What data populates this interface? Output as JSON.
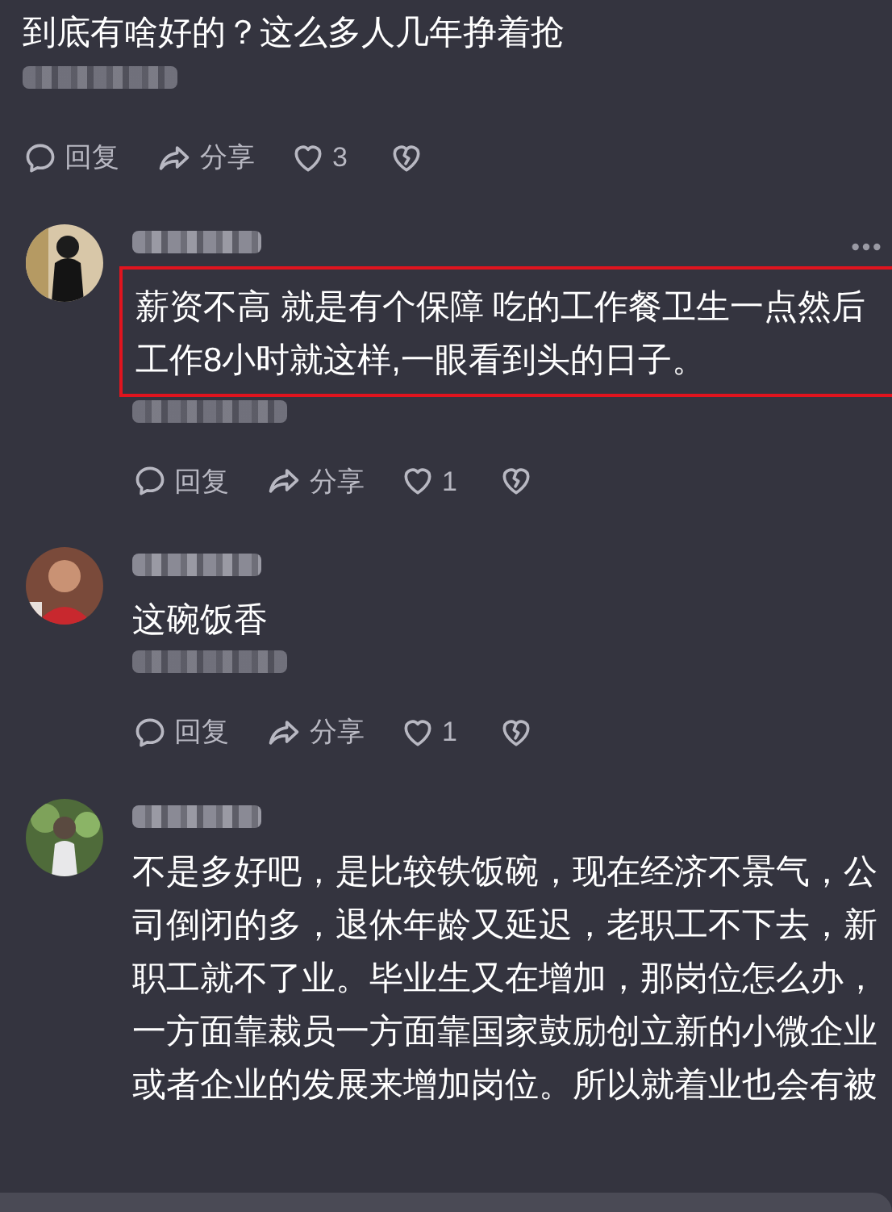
{
  "post": {
    "text": "到底有啥好的？这么多人几年挣着抢",
    "meta_redacted": true,
    "actions": {
      "reply": "回复",
      "share": "分享",
      "likes": "3"
    }
  },
  "comments": [
    {
      "author_redacted": true,
      "more_button": true,
      "highlighted": true,
      "text": "薪资不高 就是有个保障 吃的工作餐卫生一点然后工作8小时就这样,一眼看到头的日子。",
      "meta_redacted": true,
      "actions": {
        "reply": "回复",
        "share": "分享",
        "likes": "1"
      }
    },
    {
      "author_redacted": true,
      "more_button": false,
      "highlighted": false,
      "text": "这碗饭香",
      "meta_redacted": true,
      "actions": {
        "reply": "回复",
        "share": "分享",
        "likes": "1"
      }
    },
    {
      "author_redacted": true,
      "more_button": false,
      "highlighted": false,
      "text": "不是多好吧，是比较铁饭碗，现在经济不景气，公司倒闭的多，退休年龄又延迟，老职工不下去，新职工就不了业。毕业生又在增加，那岗位怎么办，一方面靠裁员一方面靠国家鼓励创立新的小微企业或者企业的发展来增加岗位。所以就着业也会有被"
    }
  ]
}
